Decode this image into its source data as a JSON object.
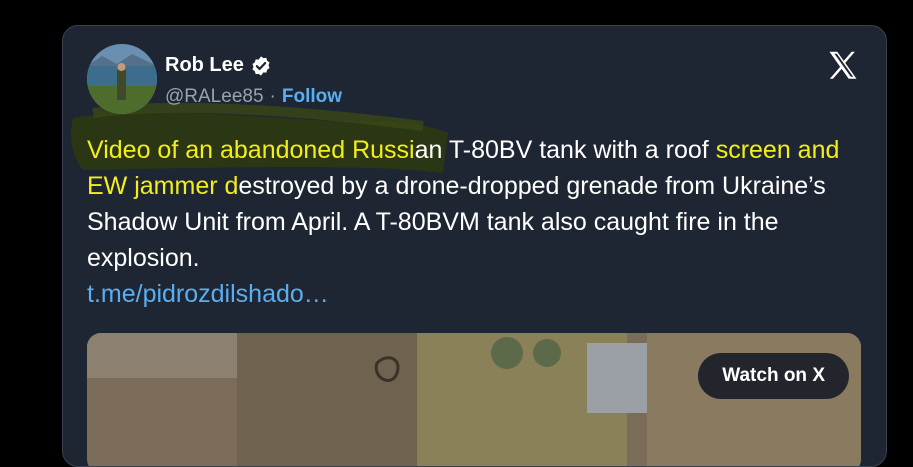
{
  "author": {
    "name": "Rob Lee",
    "handle": "@RALee85",
    "separator": "·",
    "follow_label": "Follow"
  },
  "icons": {
    "verified": "verified-badge-icon",
    "x_logo": "x-logo-icon"
  },
  "tweet": {
    "text_highlight_1": "Video of an abandoned Russi",
    "text_normal_1": "an T-80BV tank with a roof ",
    "text_highlight_2": "screen and EW jammer d",
    "text_normal_2": "estroyed by a drone-dropped grenade from Ukraine’s Shadow Unit from April. A T-80BVM tank also caught fire in the explosion.",
    "link": "t.me/pidrozdilshado…"
  },
  "media": {
    "watch_label": "Watch on X"
  },
  "colors": {
    "card_bg": "#1f2633",
    "highlight": "#f3ee18",
    "link": "#5aaef0"
  }
}
